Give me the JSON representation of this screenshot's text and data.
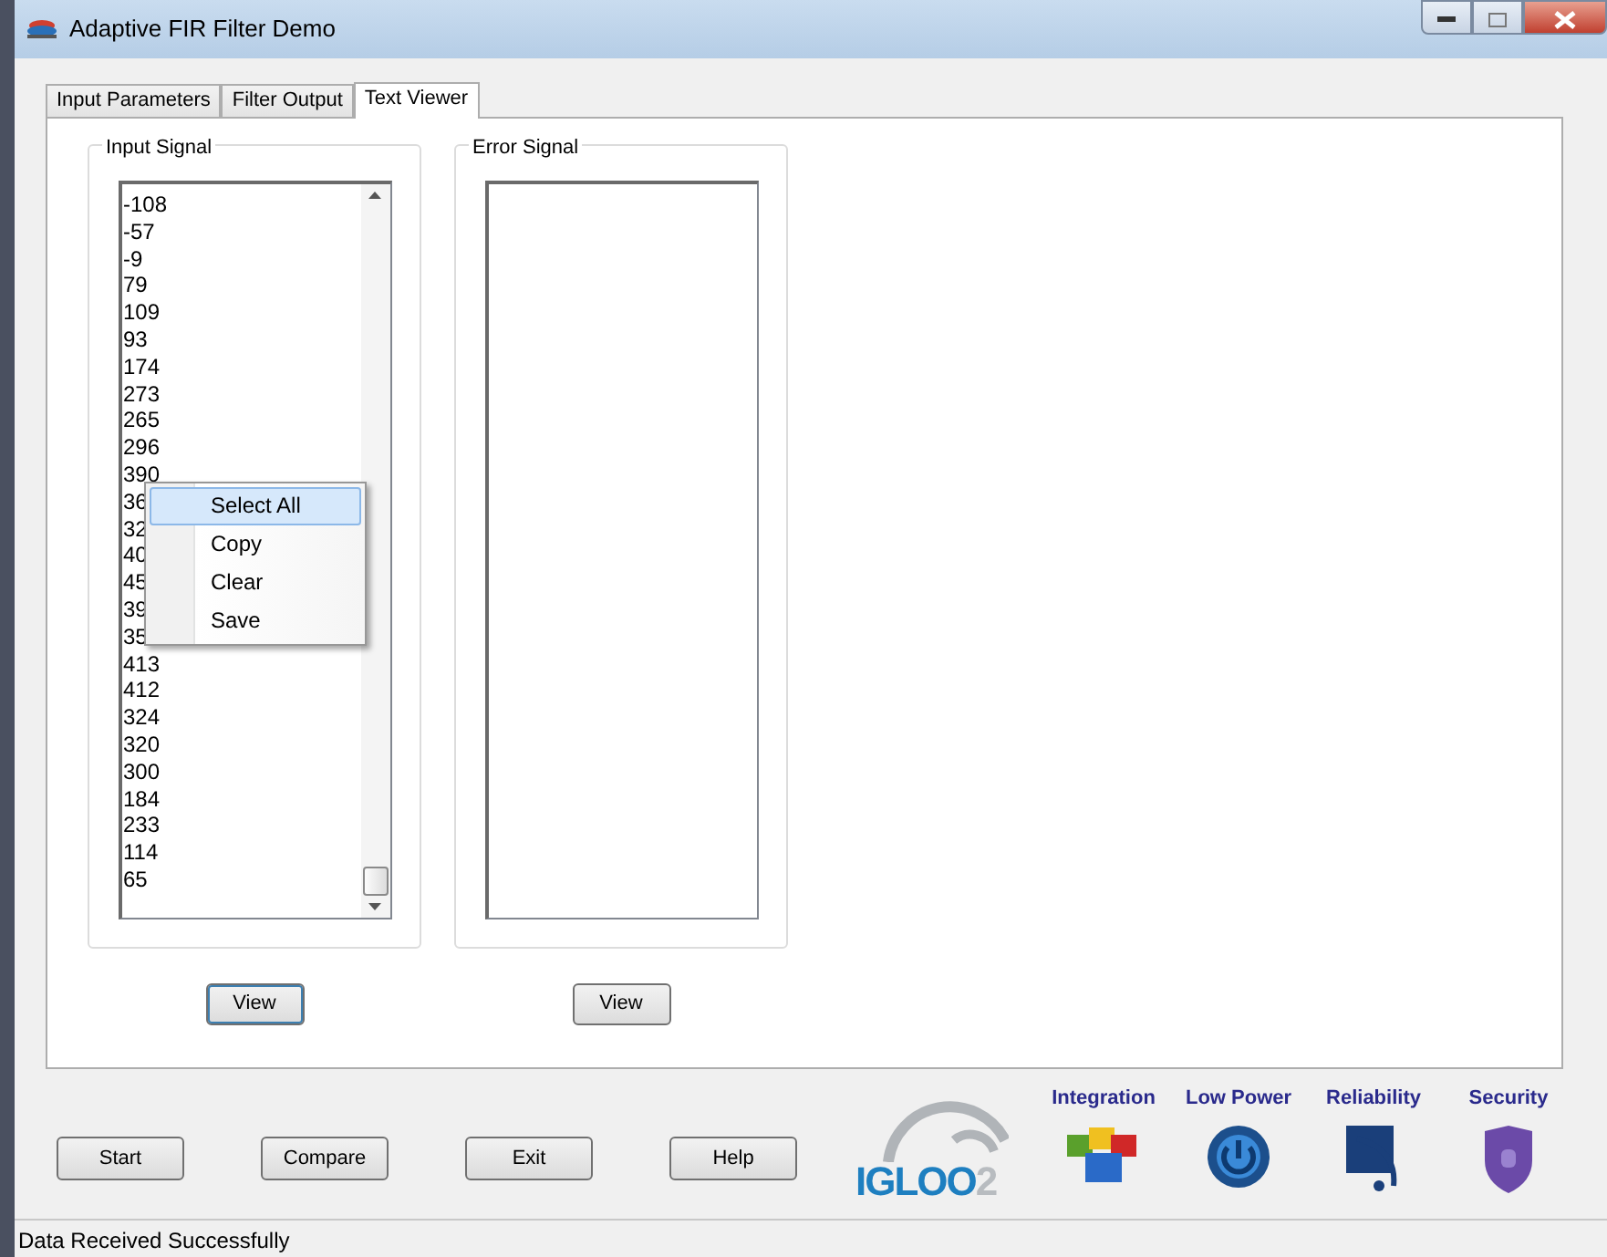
{
  "window": {
    "title": "Adaptive FIR Filter Demo"
  },
  "tabs": [
    {
      "label": "Input Parameters",
      "selected": false
    },
    {
      "label": "Filter Output",
      "selected": false
    },
    {
      "label": "Text Viewer",
      "selected": true
    }
  ],
  "input_signal": {
    "title": "Input Signal",
    "lines": [
      "-108",
      "-57",
      "-9",
      "79",
      "109",
      "93",
      "174",
      "273",
      "265",
      "296",
      "390",
      "36",
      "32",
      "40",
      "45",
      "39",
      "35",
      "413",
      "412",
      "324",
      "320",
      "300",
      "184",
      "233",
      "114",
      "65"
    ],
    "button": "View"
  },
  "error_signal": {
    "title": "Error Signal",
    "button": "View"
  },
  "context_menu": {
    "items": [
      {
        "label": "Select All",
        "selected": true
      },
      {
        "label": "Copy",
        "selected": false
      },
      {
        "label": "Clear",
        "selected": false
      },
      {
        "label": "Save",
        "selected": false
      }
    ]
  },
  "buttons": [
    "Start",
    "Compare",
    "Exit",
    "Help"
  ],
  "logo": {
    "name": "IGLOO",
    "number": "2"
  },
  "features": [
    {
      "label": "Integration",
      "kind": "puzzle"
    },
    {
      "label": "Low Power",
      "kind": "power"
    },
    {
      "label": "Reliability",
      "kind": "reliability"
    },
    {
      "label": "Security",
      "kind": "shield"
    }
  ],
  "status_bar": "Data Received Successfully"
}
